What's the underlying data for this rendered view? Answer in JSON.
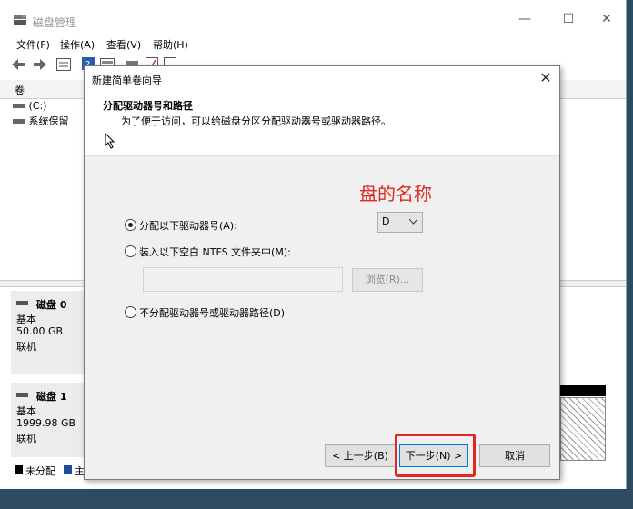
{
  "app": {
    "title": "磁盘管理",
    "window_controls": [
      "minimize-icon",
      "maximize-icon",
      "close-icon"
    ]
  },
  "menu": [
    "文件(F)",
    "操作(A)",
    "查看(V)",
    "帮助(H)"
  ],
  "volume_list": {
    "header": "卷",
    "volumes": [
      {
        "name": "(C:)",
        "icon": "drive-icon"
      },
      {
        "name": "系统保留",
        "icon": "drive-icon"
      }
    ]
  },
  "disks": [
    {
      "name": "磁盘 0",
      "type": "基本",
      "size": "50.00 GB",
      "status": "联机"
    },
    {
      "name": "磁盘 1",
      "type": "基本",
      "size": "1999.98 GB",
      "status": "联机"
    }
  ],
  "legend": [
    {
      "label": "未分配",
      "color": "#000000"
    },
    {
      "label": "主",
      "color": "#1f4e9c"
    }
  ],
  "dialog": {
    "title": "新建简单卷向导",
    "heading": "分配驱动器号和路径",
    "description": "为了便于访问，可以给磁盘分区分配驱动器号或驱动器路径。",
    "options": [
      {
        "label": "分配以下驱动器号(A):",
        "selected": true
      },
      {
        "label": "装入以下空白 NTFS 文件夹中(M):",
        "selected": false
      },
      {
        "label": "不分配驱动器号或驱动器路径(D)",
        "selected": false
      }
    ],
    "drive_letter": "D",
    "folder_path": "",
    "browse_label": "浏览(R)...",
    "back_label": "< 上一步(B)",
    "next_label": "下一步(N) >",
    "cancel_label": "取消"
  },
  "annotation": {
    "text": "盘的名称",
    "color": "#e0281e"
  }
}
